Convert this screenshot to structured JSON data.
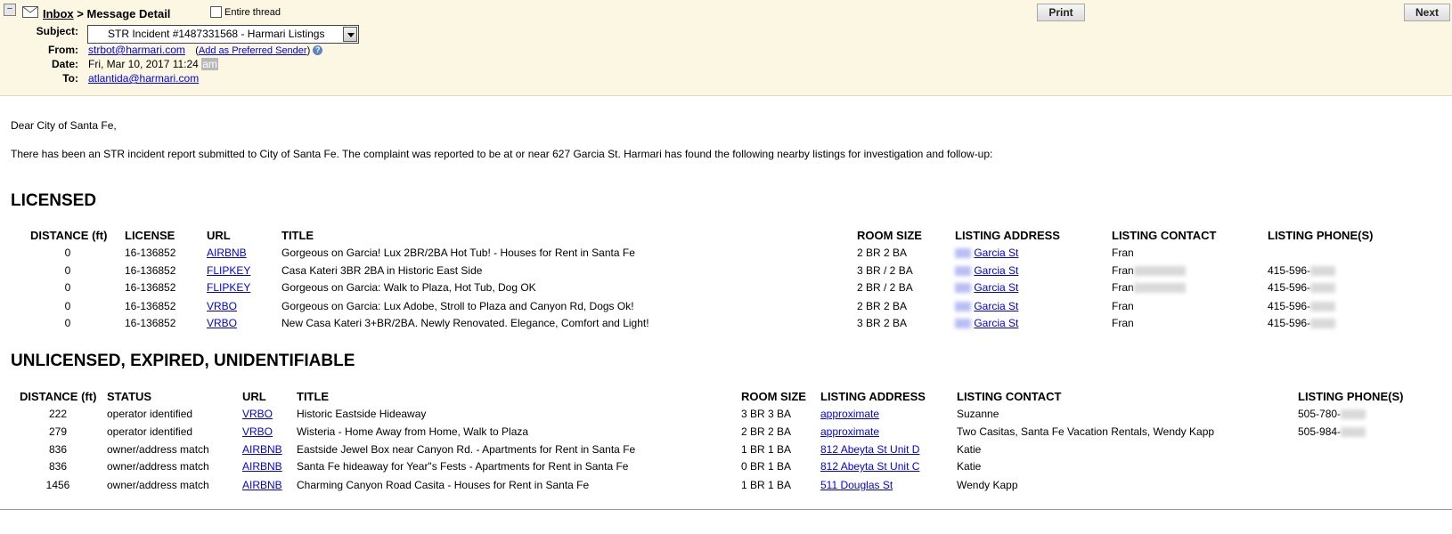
{
  "header": {
    "inbox_link": "Inbox",
    "crumb_tail": " > Message Detail",
    "entire_thread_label": "Entire thread",
    "print_label": "Print",
    "next_label": "Next",
    "subject_label": "Subject:",
    "subject_value": "STR Incident #1487331568 - Harmari Listings",
    "from_label": "From:",
    "from_value": "strbot@harmari.com",
    "add_preferred": "Add as Preferred Sender",
    "date_label": "Date:",
    "date_value": "Fri, Mar 10, 2017 11:24",
    "date_ampm": "am",
    "to_label": "To:",
    "to_value": "atlantida@harmari.com"
  },
  "message": {
    "greeting": "Dear City of Santa Fe,",
    "intro": "There has been an STR incident report submitted to City of Santa Fe. The complaint was reported to be at or near 627 Garcia St. Harmari has found the following nearby listings for investigation and follow-up:"
  },
  "licensed": {
    "heading": "LICENSED",
    "columns": [
      "DISTANCE (ft)",
      "LICENSE",
      "URL",
      "TITLE",
      "ROOM SIZE",
      "LISTING ADDRESS",
      "LISTING CONTACT",
      "LISTING PHONE(S)"
    ],
    "rows": [
      {
        "distance": "0",
        "license": "16-136852",
        "url": "AIRBNB",
        "title": "Gorgeous on Garcia! Lux 2BR/2BA Hot Tub! - Houses for Rent in Santa Fe",
        "room": "2 BR 2 BA",
        "address": "Garcia St",
        "contact": "Fran",
        "contact_redacted": false,
        "phone": ""
      },
      {
        "distance": "0",
        "license": "16-136852",
        "url": "FLIPKEY",
        "title": "Casa Kateri 3BR 2BA in Historic East Side",
        "room": "3 BR / 2 BA",
        "address": "Garcia St",
        "contact": "Fran",
        "contact_redacted": true,
        "phone": "415-596-"
      },
      {
        "distance": "0",
        "license": "16-136852",
        "url": "FLIPKEY",
        "title": "Gorgeous on Garcia: Walk to Plaza, Hot Tub, Dog OK",
        "room": "2 BR / 2 BA",
        "address": "Garcia St",
        "contact": "Fran",
        "contact_redacted": true,
        "phone": "415-596-"
      },
      {
        "distance": "0",
        "license": "16-136852",
        "url": "VRBO",
        "title": "Gorgeous on Garcia: Lux Adobe, Stroll to Plaza and Canyon Rd, Dogs Ok!",
        "room": "2 BR 2 BA",
        "address": "Garcia St",
        "contact": "Fran",
        "contact_redacted": false,
        "phone": "415-596-"
      },
      {
        "distance": "0",
        "license": "16-136852",
        "url": "VRBO",
        "title": "New Casa Kateri 3+BR/2BA. Newly Renovated. Elegance, Comfort and Light!",
        "room": "3 BR 2 BA",
        "address": "Garcia St",
        "contact": "Fran",
        "contact_redacted": false,
        "phone": "415-596-"
      }
    ]
  },
  "unlicensed": {
    "heading": "UNLICENSED, EXPIRED, UNIDENTIFIABLE",
    "columns": [
      "DISTANCE (ft)",
      "STATUS",
      "URL",
      "TITLE",
      "ROOM SIZE",
      "LISTING ADDRESS",
      "LISTING CONTACT",
      "LISTING PHONE(S)"
    ],
    "rows": [
      {
        "distance": "222",
        "status": "operator identified",
        "url": "VRBO",
        "title": "Historic Eastside Hideaway",
        "room": "3 BR 3 BA",
        "address": "approximate",
        "contact": "Suzanne",
        "phone": "505-780-"
      },
      {
        "distance": "279",
        "status": "operator identified",
        "url": "VRBO",
        "title": "Wisteria - Home Away from Home, Walk to Plaza",
        "room": "2 BR 2 BA",
        "address": "approximate",
        "contact": "Two Casitas, Santa Fe Vacation Rentals, Wendy Kapp",
        "phone": "505-984-"
      },
      {
        "distance": "836",
        "status": "owner/address match",
        "url": "AIRBNB",
        "title": "Eastside Jewel Box near Canyon Rd. - Apartments for Rent in Santa Fe",
        "room": "1 BR 1 BA",
        "address": "812 Abeyta St Unit D",
        "contact": "Katie",
        "phone": ""
      },
      {
        "distance": "836",
        "status": "owner/address match",
        "url": "AIRBNB",
        "title": "Santa Fe hideaway for Year\"s Fests - Apartments for Rent in Santa Fe",
        "room": "0 BR 1 BA",
        "address": "812 Abeyta St Unit C",
        "contact": "Katie",
        "phone": ""
      },
      {
        "distance": "1456",
        "status": "owner/address match",
        "url": "AIRBNB",
        "title": "Charming Canyon Road Casita - Houses for Rent in Santa Fe",
        "room": "1 BR 1 BA",
        "address": "511 Douglas St",
        "contact": "Wendy Kapp",
        "phone": ""
      }
    ]
  }
}
